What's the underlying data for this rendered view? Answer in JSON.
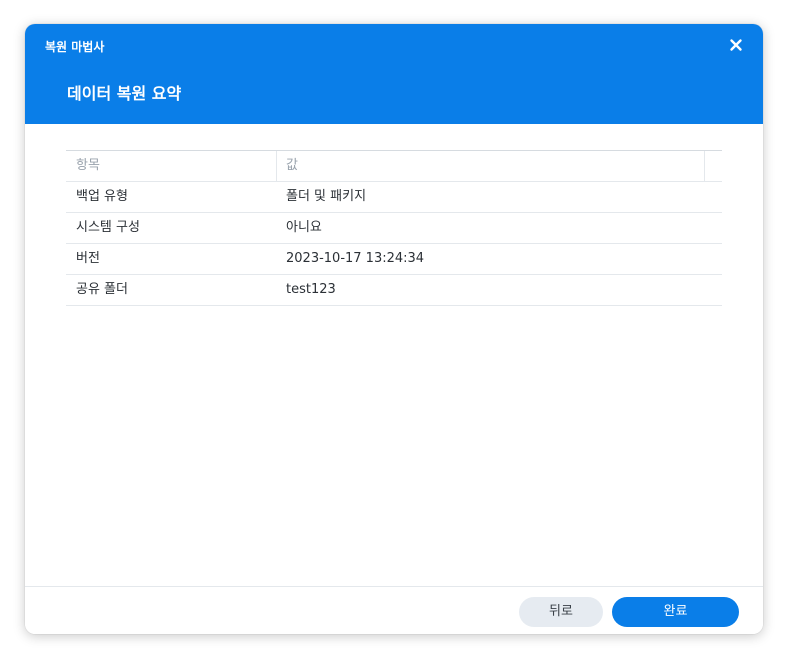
{
  "window": {
    "title": "복원 마법사",
    "page_title": "데이터 복원 요약"
  },
  "table": {
    "headers": [
      "항목",
      "값"
    ],
    "rows": [
      {
        "item": "백업 유형",
        "value": "폴더 및 패키지"
      },
      {
        "item": "시스템 구성",
        "value": "아니요"
      },
      {
        "item": "버전",
        "value": "2023-10-17 13:24:34"
      },
      {
        "item": "공유 폴더",
        "value": "test123"
      }
    ]
  },
  "footer": {
    "back_label": "뒤로",
    "finish_label": "완료"
  },
  "icons": {
    "close": "close-icon"
  },
  "colors": {
    "accent": "#0a7ee8",
    "secondary_button": "#e6ebf1"
  }
}
